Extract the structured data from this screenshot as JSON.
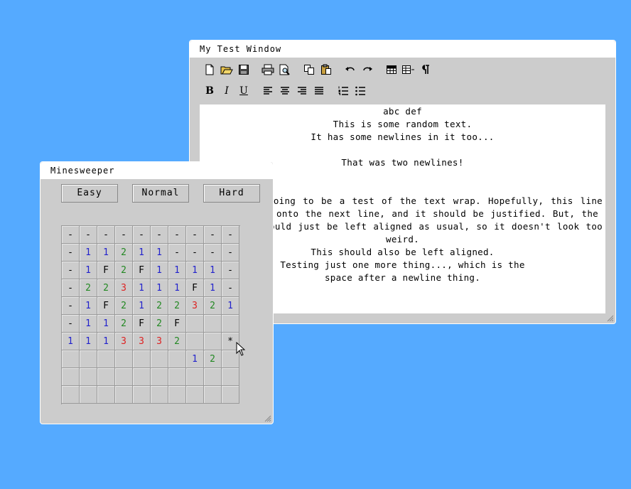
{
  "desktop": {
    "background": "#55aaff"
  },
  "text_window": {
    "title": "My Test Window",
    "toolbar_row1": [
      "new-file-icon",
      "open-folder-icon",
      "save-icon",
      "print-icon",
      "print-preview-icon",
      "copy-icon",
      "paste-icon",
      "undo-icon",
      "redo-icon",
      "table-icon",
      "table-columns-icon",
      "paragraph-mark-icon"
    ],
    "toolbar_row2": {
      "bold": "B",
      "italic": "I",
      "underline": "U",
      "icons": [
        "align-left-icon",
        "align-center-icon",
        "align-right-icon",
        "align-justify-icon",
        "numbered-list-icon",
        "bullet-list-icon"
      ]
    },
    "lines": [
      "abc def",
      "This is some random text.",
      "It has some newlines in it too...",
      "",
      "That was two newlines!",
      "",
      "going to be a test of the text wrap. Hopefully, this line",
      "onto the next line, and it should be justified. But, the",
      "ould just be left aligned as usual, so it doesn't look too",
      "weird.",
      "This should also be left aligned.",
      "Testing just one more thing..., which is the",
      "space after a newline thing."
    ]
  },
  "minesweeper": {
    "title": "Minesweeper",
    "buttons": {
      "easy": "Easy",
      "normal": "Normal",
      "hard": "Hard"
    },
    "colors": {
      "1": "#2222cc",
      "2": "#228822",
      "3": "#dd2222",
      "F": "#000000",
      "-": "#000000",
      "*": "#000000"
    },
    "board": [
      [
        "-",
        "-",
        "-",
        "-",
        "-",
        "-",
        "-",
        "-",
        "-",
        "-"
      ],
      [
        "-",
        "1",
        "1",
        "2",
        "1",
        "1",
        "-",
        "-",
        "-",
        "-"
      ],
      [
        "-",
        "1",
        "F",
        "2",
        "F",
        "1",
        "1",
        "1",
        "1",
        "-"
      ],
      [
        "-",
        "2",
        "2",
        "3",
        "1",
        "1",
        "1",
        "F",
        "1",
        "-"
      ],
      [
        "-",
        "1",
        "F",
        "2",
        "1",
        "2",
        "2",
        "3",
        "2",
        "1"
      ],
      [
        "-",
        "1",
        "1",
        "2",
        "F",
        "2",
        "F",
        "",
        "",
        ""
      ],
      [
        "1",
        "1",
        "1",
        "3",
        "3",
        "3",
        "2",
        "",
        "",
        "*"
      ],
      [
        "",
        "",
        "",
        "",
        "",
        "",
        "",
        "1",
        "2",
        ""
      ],
      [
        "",
        "",
        "",
        "",
        "",
        "",
        "",
        "",
        "",
        ""
      ],
      [
        "",
        "",
        "",
        "",
        "",
        "",
        "",
        "",
        "",
        ""
      ]
    ]
  }
}
